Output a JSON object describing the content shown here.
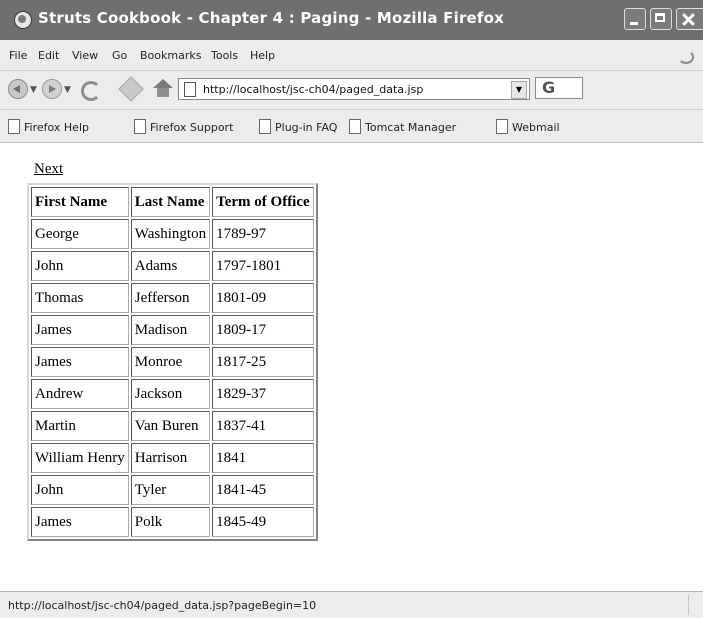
{
  "window": {
    "title": "Struts Cookbook - Chapter 4 : Paging - Mozilla Firefox"
  },
  "menu": [
    "File",
    "Edit",
    "View",
    "Go",
    "Bookmarks",
    "Tools",
    "Help"
  ],
  "nav": {
    "url": "http://localhost/jsc-ch04/paged_data.jsp",
    "search_label": "G"
  },
  "bookmarks": [
    "Firefox Help",
    "Firefox Support",
    "Plug-in FAQ",
    "Tomcat Manager",
    "Webmail"
  ],
  "page": {
    "next_link": "Next",
    "table": {
      "headers": [
        "First Name",
        "Last Name",
        "Term of Office"
      ],
      "rows": [
        [
          "George",
          "Washington",
          "1789-97"
        ],
        [
          "John",
          "Adams",
          "1797-1801"
        ],
        [
          "Thomas",
          "Jefferson",
          "1801-09"
        ],
        [
          "James",
          "Madison",
          "1809-17"
        ],
        [
          "James",
          "Monroe",
          "1817-25"
        ],
        [
          "Andrew",
          "Jackson",
          "1829-37"
        ],
        [
          "Martin",
          "Van Buren",
          "1837-41"
        ],
        [
          "William Henry",
          "Harrison",
          "1841"
        ],
        [
          "John",
          "Tyler",
          "1841-45"
        ],
        [
          "James",
          "Polk",
          "1845-49"
        ]
      ]
    }
  },
  "status": {
    "text": "http://localhost/jsc-ch04/paged_data.jsp?pageBegin=10"
  }
}
